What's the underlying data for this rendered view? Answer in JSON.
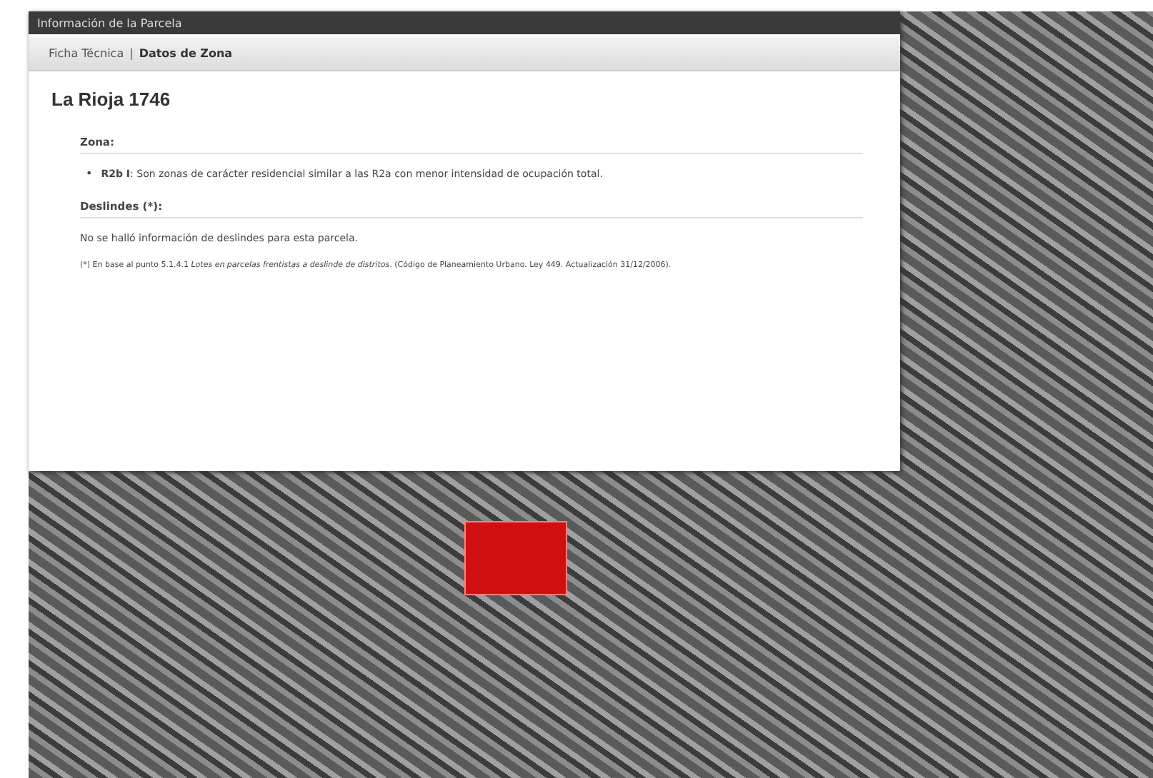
{
  "window": {
    "title": "Información de la Parcela"
  },
  "tabs": [
    {
      "label": "Ficha Técnica",
      "selected": false
    },
    {
      "label": "Datos de Zona",
      "selected": true
    }
  ],
  "tab_separator": "|",
  "heading": "La Rioja 1746",
  "sections": [
    {
      "title": "Zona:",
      "bullet": "•",
      "items": [
        "**R2b I**: Son zonas de carácter residencial similar a las R2a con menor intensidad de ocupación total."
      ]
    },
    {
      "title": "Deslindes (*):",
      "text": "No se halló información de deslindes para esta parcela."
    }
  ],
  "footnote": "(*) En base al punto 5.1.4.1 *Lotes en parcelas frentistas a deslinde de distritos*. (Código de Planeamiento Urbano. Ley 449. Actualización 31/12/2006)."
}
